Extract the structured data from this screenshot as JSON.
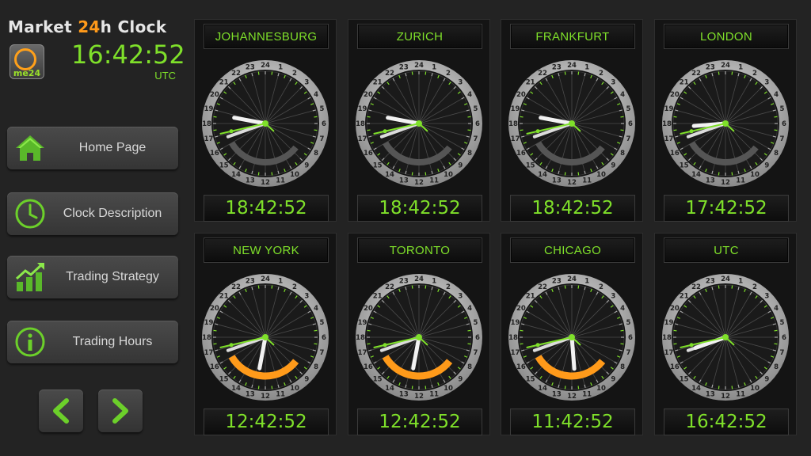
{
  "header": {
    "brand_pre": "Market ",
    "brand_hl": "24",
    "brand_post": "h Clock",
    "logo_text": "me24",
    "time": "16:42:52",
    "tz": "UTC"
  },
  "nav": [
    {
      "label": "Home Page",
      "icon": "home-icon"
    },
    {
      "label": "Clock Description",
      "icon": "clock-icon"
    },
    {
      "label": "Trading Strategy",
      "icon": "chart-icon"
    },
    {
      "label": "Trading Hours",
      "icon": "info-icon"
    }
  ],
  "pager": {
    "prev_icon": "chevron-left-icon",
    "next_icon": "chevron-right-icon"
  },
  "colors": {
    "accent_green": "#7fe02a",
    "brand_orange": "#ff9a1a",
    "session_open": "#ff9a1a",
    "session_closed": "#555555"
  },
  "clocks": [
    {
      "city": "JOHANNESBURG",
      "time": "18:42:52",
      "session": "closed"
    },
    {
      "city": "ZURICH",
      "time": "18:42:52",
      "session": "closed"
    },
    {
      "city": "FRANKFURT",
      "time": "18:42:52",
      "session": "closed"
    },
    {
      "city": "LONDON",
      "time": "17:42:52",
      "session": "closed"
    },
    {
      "city": "NEW YORK",
      "time": "12:42:52",
      "session": "open"
    },
    {
      "city": "TORONTO",
      "time": "12:42:52",
      "session": "open"
    },
    {
      "city": "CHICAGO",
      "time": "11:42:52",
      "session": "open"
    },
    {
      "city": "UTC",
      "time": "16:42:52",
      "session": "none"
    }
  ],
  "dial_numbers": [
    "24",
    "1",
    "2",
    "3",
    "4",
    "5",
    "6",
    "7",
    "8",
    "9",
    "10",
    "11",
    "12",
    "13",
    "14",
    "15",
    "16",
    "17",
    "18",
    "19",
    "20",
    "21",
    "22",
    "23"
  ]
}
